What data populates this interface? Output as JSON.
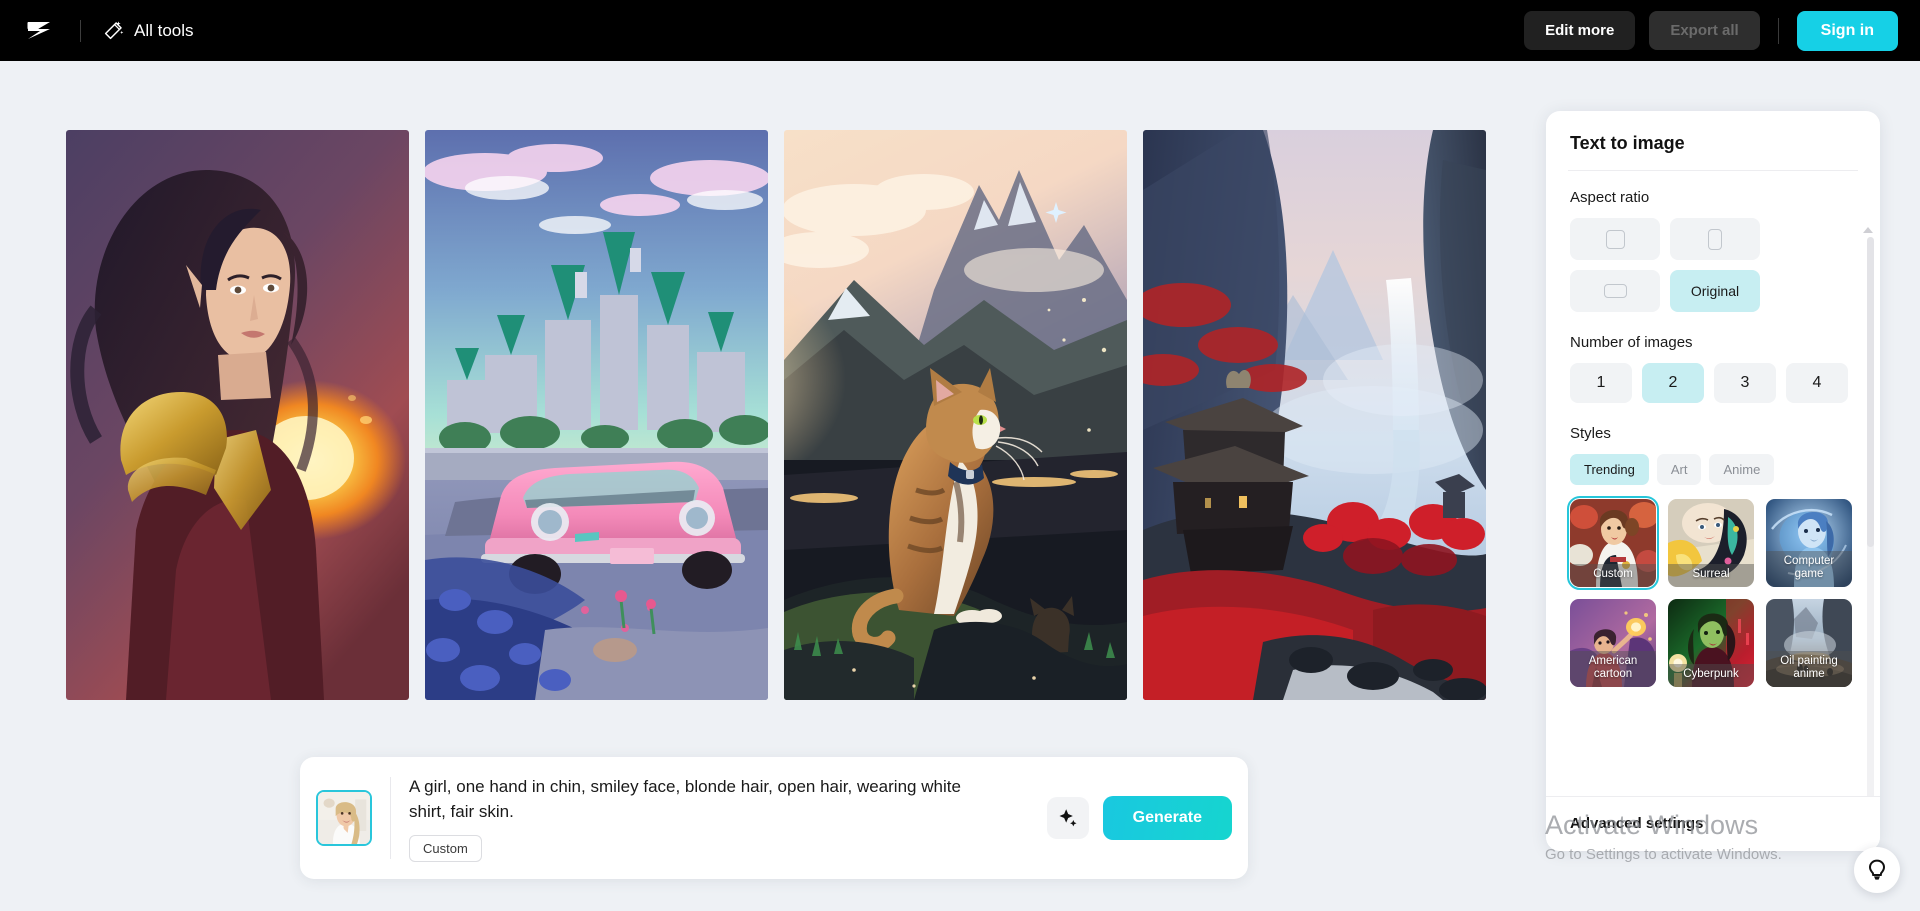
{
  "topbar": {
    "logo_icon": "capcut-logo-icon",
    "all_tools_icon": "magic-wand-icon",
    "all_tools_label": "All tools",
    "edit_more_label": "Edit more",
    "export_all_label": "Export all",
    "sign_in_label": "Sign in",
    "background_color": "#000000",
    "accent_color": "#16d0e6"
  },
  "gallery": {
    "images": [
      {
        "alt": "fantasy warrior woman with fireball",
        "name": "generated-image-1"
      },
      {
        "alt": "pink retro sports car in front of castle",
        "name": "generated-image-2"
      },
      {
        "alt": "tabby cat sitting on rock at sunrise mountains",
        "name": "generated-image-3"
      },
      {
        "alt": "misty canyon with pagoda and red foliage",
        "name": "generated-image-4"
      }
    ]
  },
  "prompt_bar": {
    "thumbnail_alt": "smiling blonde woman in white shirt",
    "prompt_text": "A girl, one hand in chin, smiley face, blonde hair, open hair, wearing white shirt, fair skin.",
    "style_tag": "Custom",
    "magic_icon": "sparkle-icon",
    "generate_label": "Generate",
    "generate_color": "#19c8e0"
  },
  "panel": {
    "title": "Text to image",
    "aspect_ratio": {
      "label": "Aspect ratio",
      "options": [
        {
          "label": "",
          "icon": "square-ratio-icon",
          "selected": false
        },
        {
          "label": "",
          "icon": "portrait-ratio-icon",
          "selected": false
        },
        {
          "label": "",
          "icon": "landscape-ratio-icon",
          "selected": false
        },
        {
          "label": "Original",
          "icon": "",
          "selected": true
        }
      ]
    },
    "number_of_images": {
      "label": "Number of images",
      "options": [
        "1",
        "2",
        "3",
        "4"
      ],
      "selected": "2"
    },
    "styles": {
      "label": "Styles",
      "tabs": [
        {
          "label": "Trending",
          "selected": true
        },
        {
          "label": "Art",
          "selected": false
        },
        {
          "label": "Anime",
          "selected": false
        }
      ],
      "cards": [
        {
          "label": "Custom",
          "selected": true
        },
        {
          "label": "Surreal",
          "selected": false
        },
        {
          "label": "Computer game",
          "selected": false
        },
        {
          "label": "American cartoon",
          "selected": false
        },
        {
          "label": "Cyberpunk",
          "selected": false
        },
        {
          "label": "Oil painting anime",
          "selected": false
        }
      ],
      "selected_color": "#26c6da"
    },
    "advanced_settings_label": "Advanced settings"
  },
  "watermark": {
    "line1": "Activate Windows",
    "line2": "Go to Settings to activate Windows."
  },
  "help": {
    "icon": "lightbulb-icon"
  }
}
